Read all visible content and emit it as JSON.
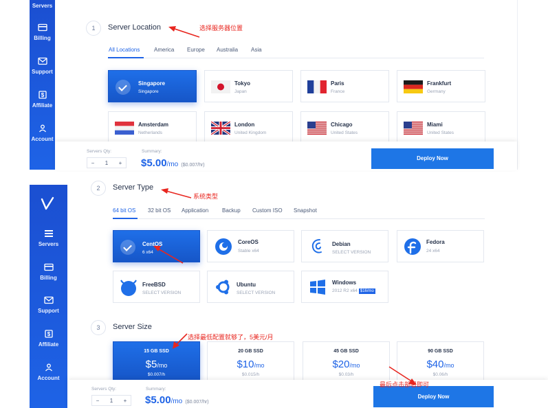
{
  "top": {
    "sidebar": {
      "items": [
        {
          "label": "Servers",
          "icon": "servers-icon"
        },
        {
          "label": "Billing",
          "icon": "billing-icon"
        },
        {
          "label": "Support",
          "icon": "support-icon"
        },
        {
          "label": "Affiliate",
          "icon": "affiliate-icon"
        },
        {
          "label": "Account",
          "icon": "account-icon"
        }
      ]
    },
    "step_number": "1",
    "step_title": "Server Location",
    "annotation": "选择服务器位置",
    "tabs": [
      "All Locations",
      "America",
      "Europe",
      "Australia",
      "Asia"
    ],
    "active_tab": "All Locations",
    "locations": [
      {
        "name": "Singapore",
        "country": "Singapore",
        "selected": true
      },
      {
        "name": "Tokyo",
        "country": "Japan",
        "flag": "japan"
      },
      {
        "name": "Paris",
        "country": "France",
        "flag": "france"
      },
      {
        "name": "Frankfurt",
        "country": "Germany",
        "flag": "germany"
      },
      {
        "name": "Amsterdam",
        "country": "Netherlands",
        "flag": "netherlands"
      },
      {
        "name": "London",
        "country": "United Kingdom",
        "flag": "uk"
      },
      {
        "name": "Chicago",
        "country": "United States",
        "flag": "us"
      },
      {
        "name": "Miami",
        "country": "United States",
        "flag": "us"
      }
    ],
    "bottom": {
      "qty_label": "Servers Qty:",
      "qty": "1",
      "minus": "−",
      "plus": "+",
      "summary_label": "Summary:",
      "price": "$5.00",
      "per": "/mo",
      "hourly": "($0.007/hr)",
      "deploy": "Deploy Now"
    }
  },
  "bottom_panel": {
    "logo": "V",
    "sidebar": {
      "items": [
        {
          "label": "Servers",
          "icon": "servers-icon"
        },
        {
          "label": "Billing",
          "icon": "billing-icon"
        },
        {
          "label": "Support",
          "icon": "support-icon"
        },
        {
          "label": "Affiliate",
          "icon": "affiliate-icon"
        },
        {
          "label": "Account",
          "icon": "account-icon"
        }
      ]
    },
    "type_step": {
      "number": "2",
      "title": "Server Type",
      "annotation": "系统类型",
      "tabs": [
        "64 bit OS",
        "32 bit OS",
        "Application",
        "Backup",
        "Custom ISO",
        "Snapshot"
      ],
      "active_tab": "64 bit OS",
      "os": [
        {
          "name": "CentOS",
          "version": "6 x64",
          "selected": true
        },
        {
          "name": "CoreOS",
          "version": "Stable x64",
          "icon": "coreos-icon"
        },
        {
          "name": "Debian",
          "version": "SELECT VERSION",
          "icon": "debian-icon"
        },
        {
          "name": "Fedora",
          "version": "24 x64",
          "icon": "fedora-icon"
        },
        {
          "name": "FreeBSD",
          "version": "SELECT VERSION",
          "icon": "freebsd-icon"
        },
        {
          "name": "Ubuntu",
          "version": "SELECT VERSION",
          "icon": "ubuntu-icon"
        },
        {
          "name": "Windows",
          "version": "2012 R2 x64",
          "badge": "$16/mo",
          "icon": "windows-icon"
        }
      ]
    },
    "size_step": {
      "number": "3",
      "title": "Server Size",
      "annotation": "选择最低配置就够了，5美元/月",
      "sizes": [
        {
          "label": "15 GB SSD",
          "price": "$5",
          "per": "/mo",
          "hourly": "$0.007/h",
          "selected": true
        },
        {
          "label": "20 GB SSD",
          "price": "$10",
          "per": "/mo",
          "hourly": "$0.015/h"
        },
        {
          "label": "45 GB SSD",
          "price": "$20",
          "per": "/mo",
          "hourly": "$0.03/h"
        },
        {
          "label": "90 GB SSD",
          "price": "$40",
          "per": "/mo",
          "hourly": "$0.06/h"
        }
      ]
    },
    "bottom": {
      "qty_label": "Servers Qty:",
      "qty": "1",
      "minus": "−",
      "plus": "+",
      "summary_label": "Summary:",
      "price": "$5.00",
      "per": "/mo",
      "hourly": "($0.007/hr)",
      "deploy": "Deploy Now",
      "annotation": "最后点击部署即可"
    }
  },
  "colors": {
    "accent": "#1e63e6",
    "annotation": "#e8261f"
  }
}
